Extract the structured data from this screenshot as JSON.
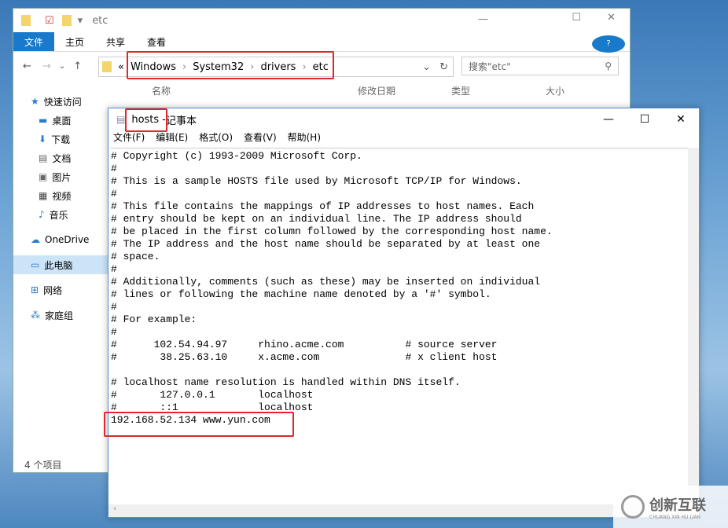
{
  "explorer": {
    "title": "etc",
    "ribbon": [
      "文件",
      "主页",
      "共享",
      "查看"
    ],
    "breadcrumb_prefix": "«",
    "breadcrumb": [
      "Windows",
      "System32",
      "drivers",
      "etc"
    ],
    "search_placeholder": "搜索\"etc\"",
    "columns": [
      "名称",
      "修改日期",
      "类型",
      "大小"
    ],
    "sidebar": [
      {
        "label": "快速访问",
        "icon": "star-icon"
      },
      {
        "label": "桌面",
        "icon": "desktop-icon"
      },
      {
        "label": "下载",
        "icon": "download-icon"
      },
      {
        "label": "文档",
        "icon": "document-icon"
      },
      {
        "label": "图片",
        "icon": "picture-icon"
      },
      {
        "label": "视频",
        "icon": "video-icon"
      },
      {
        "label": "音乐",
        "icon": "music-icon"
      },
      {
        "label": "OneDrive",
        "icon": "cloud-icon"
      },
      {
        "label": "此电脑",
        "icon": "computer-icon"
      },
      {
        "label": "网络",
        "icon": "network-icon"
      },
      {
        "label": "家庭组",
        "icon": "homegroup-icon"
      }
    ],
    "status": "4 个项目"
  },
  "notepad": {
    "title_file": "hosts - ",
    "title_app": "记事本",
    "menu": [
      "文件(F)",
      "编辑(E)",
      "格式(O)",
      "查看(V)",
      "帮助(H)"
    ],
    "content": "# Copyright (c) 1993-2009 Microsoft Corp.\n#\n# This is a sample HOSTS file used by Microsoft TCP/IP for Windows.\n#\n# This file contains the mappings of IP addresses to host names. Each\n# entry should be kept on an individual line. The IP address should\n# be placed in the first column followed by the corresponding host name.\n# The IP address and the host name should be separated by at least one\n# space.\n#\n# Additionally, comments (such as these) may be inserted on individual\n# lines or following the machine name denoted by a '#' symbol.\n#\n# For example:\n#\n#      102.54.94.97     rhino.acme.com          # source server\n#       38.25.63.10     x.acme.com              # x client host\n\n# localhost name resolution is handled within DNS itself.\n#\t127.0.0.1       localhost\n#\t::1             localhost\n192.168.52.134 www.yun.com"
  },
  "watermark": {
    "text": "创新互联",
    "subtext": "CHUANG XIN HU LIAN"
  },
  "colors": {
    "highlight": "#e0262b",
    "accent": "#1979ca"
  }
}
